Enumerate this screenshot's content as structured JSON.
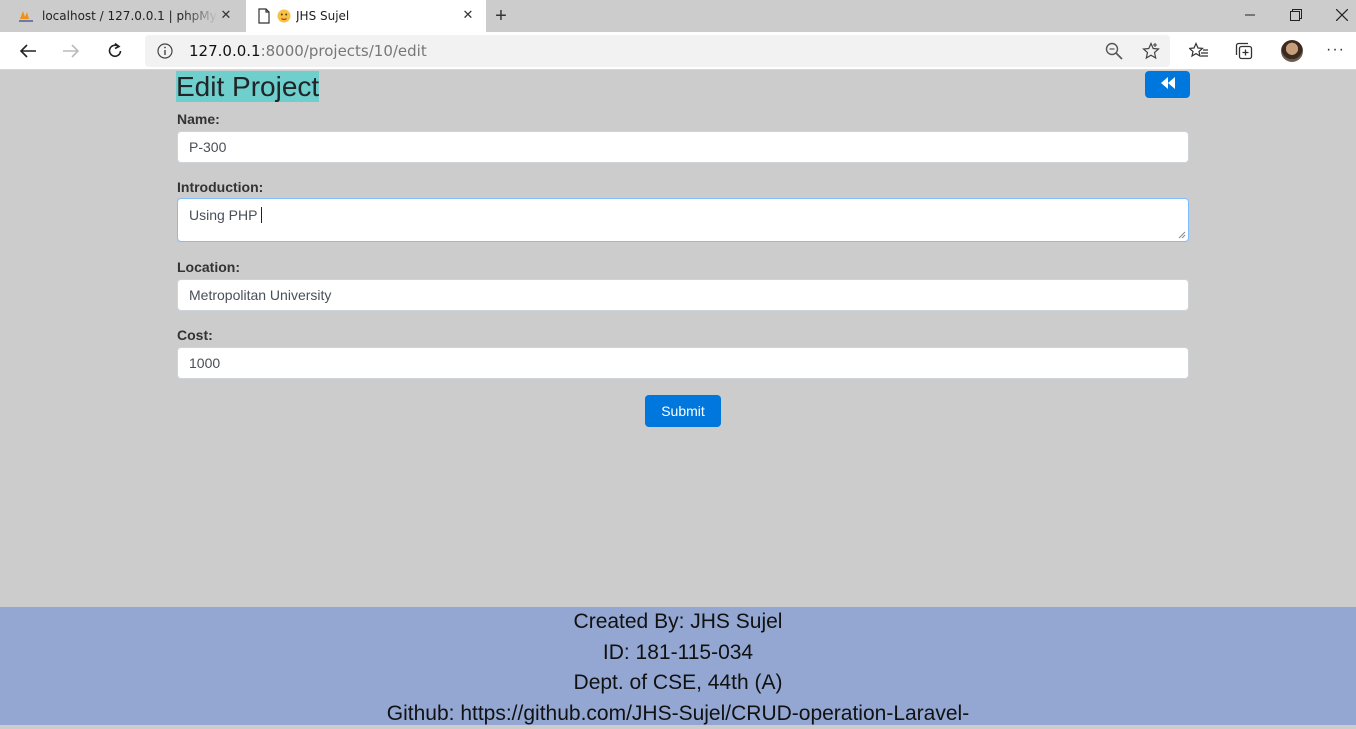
{
  "browser": {
    "tabs": [
      {
        "title": "localhost / 127.0.0.1 | phpMyAdmin",
        "icon": "phpmyadmin-icon",
        "active": false
      },
      {
        "title": "JHS Sujel",
        "icon": "emoji-face-icon",
        "active": true
      }
    ],
    "url_host": "127.0.0.1",
    "url_rest": ":8000/projects/10/edit"
  },
  "page": {
    "heading": "Edit Project",
    "fields": [
      {
        "label": "Name:",
        "value": "P-300"
      },
      {
        "label": "Introduction:",
        "value": "Using PHP"
      },
      {
        "label": "Location:",
        "value": "Metropolitan University"
      },
      {
        "label": "Cost:",
        "value": "1000"
      }
    ],
    "submit_label": "Submit",
    "colors": {
      "accent": "#0077dd",
      "heading_bg": "#6ecfcc",
      "footer_bg": "#93a7d2",
      "page_bg": "#cccccc"
    }
  },
  "footer": {
    "created_by": "Created By: JHS Sujel",
    "id": "ID: 181-115-034",
    "dept": "Dept. of CSE, 44th (A)",
    "github": "Github: https://github.com/JHS-Sujel/CRUD-operation-Laravel-"
  }
}
